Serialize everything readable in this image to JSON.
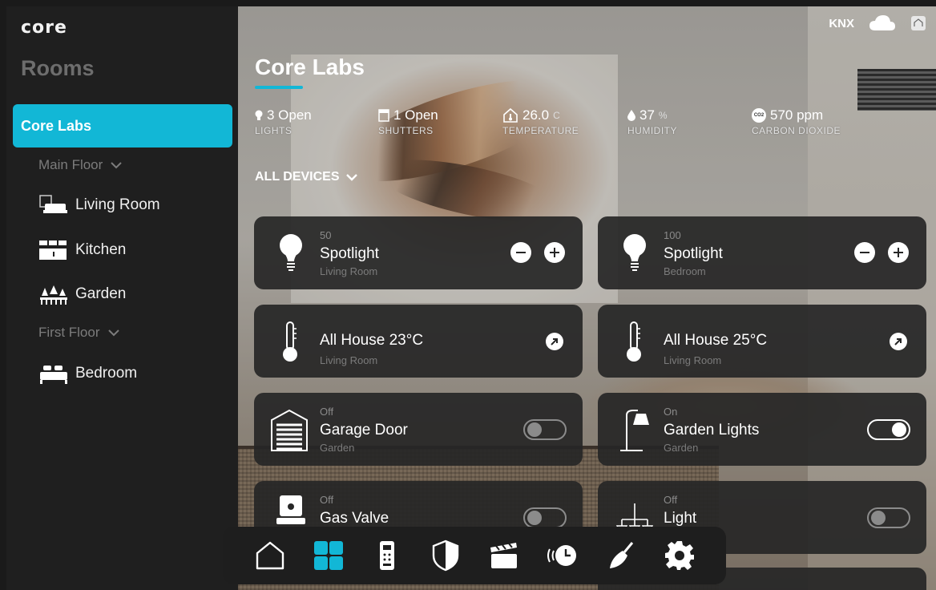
{
  "app": {
    "logo": "core"
  },
  "sidebar": {
    "title": "Rooms",
    "active_room": "Core Labs",
    "floors": [
      {
        "label": "Main Floor",
        "rooms": [
          "Living Room",
          "Kitchen",
          "Garden"
        ]
      },
      {
        "label": "First Floor",
        "rooms": [
          "Bedroom"
        ]
      }
    ]
  },
  "header": {
    "protocol": "KNX",
    "title": "Core Labs"
  },
  "stats": {
    "lights": {
      "value": "3 Open",
      "label": "LIGHTS"
    },
    "shutters": {
      "value": "1 Open",
      "label": "SHUTTERS"
    },
    "temperature": {
      "value": "26.0",
      "unit": "C",
      "label": "TEMPERATURE"
    },
    "humidity": {
      "value": "37",
      "unit": "%",
      "label": "HUMIDITY"
    },
    "co2": {
      "icon_text": "CO2",
      "value": "570 ppm",
      "label": "CARBON DIOXIDE"
    }
  },
  "filter": {
    "label": "ALL DEVICES"
  },
  "devices": [
    {
      "state": "50",
      "name": "Spotlight",
      "room": "Living Room",
      "icon": "bulb-icon",
      "control": "dimmer"
    },
    {
      "state": "100",
      "name": "Spotlight",
      "room": "Bedroom",
      "icon": "bulb-icon",
      "control": "dimmer"
    },
    {
      "state": "",
      "name": "All House 23°C",
      "room": "Living Room",
      "icon": "thermometer-icon",
      "control": "link"
    },
    {
      "state": "",
      "name": "All House 25°C",
      "room": "Living Room",
      "icon": "thermometer-icon",
      "control": "link"
    },
    {
      "state": "Off",
      "name": "Garage Door",
      "room": "Garden",
      "icon": "garage-icon",
      "control": "toggle-off"
    },
    {
      "state": "On",
      "name": "Garden Lights",
      "room": "Garden",
      "icon": "garden-lamp-icon",
      "control": "toggle-on"
    },
    {
      "state": "Off",
      "name": "Gas Valve",
      "room": "",
      "icon": "gas-valve-icon",
      "control": "toggle-off"
    },
    {
      "state": "Off",
      "name": "Light",
      "room": "",
      "icon": "chandelier-icon",
      "control": "toggle-off"
    }
  ],
  "colors": {
    "accent": "#12b7d6",
    "sidebar": "#1f1f1f",
    "card": "#262626"
  },
  "bottom_nav": [
    "home-icon",
    "rooms-grid-icon",
    "remote-icon",
    "security-shield-icon",
    "scenes-clapper-icon",
    "schedule-icon",
    "cleaning-icon",
    "settings-gear-icon"
  ]
}
